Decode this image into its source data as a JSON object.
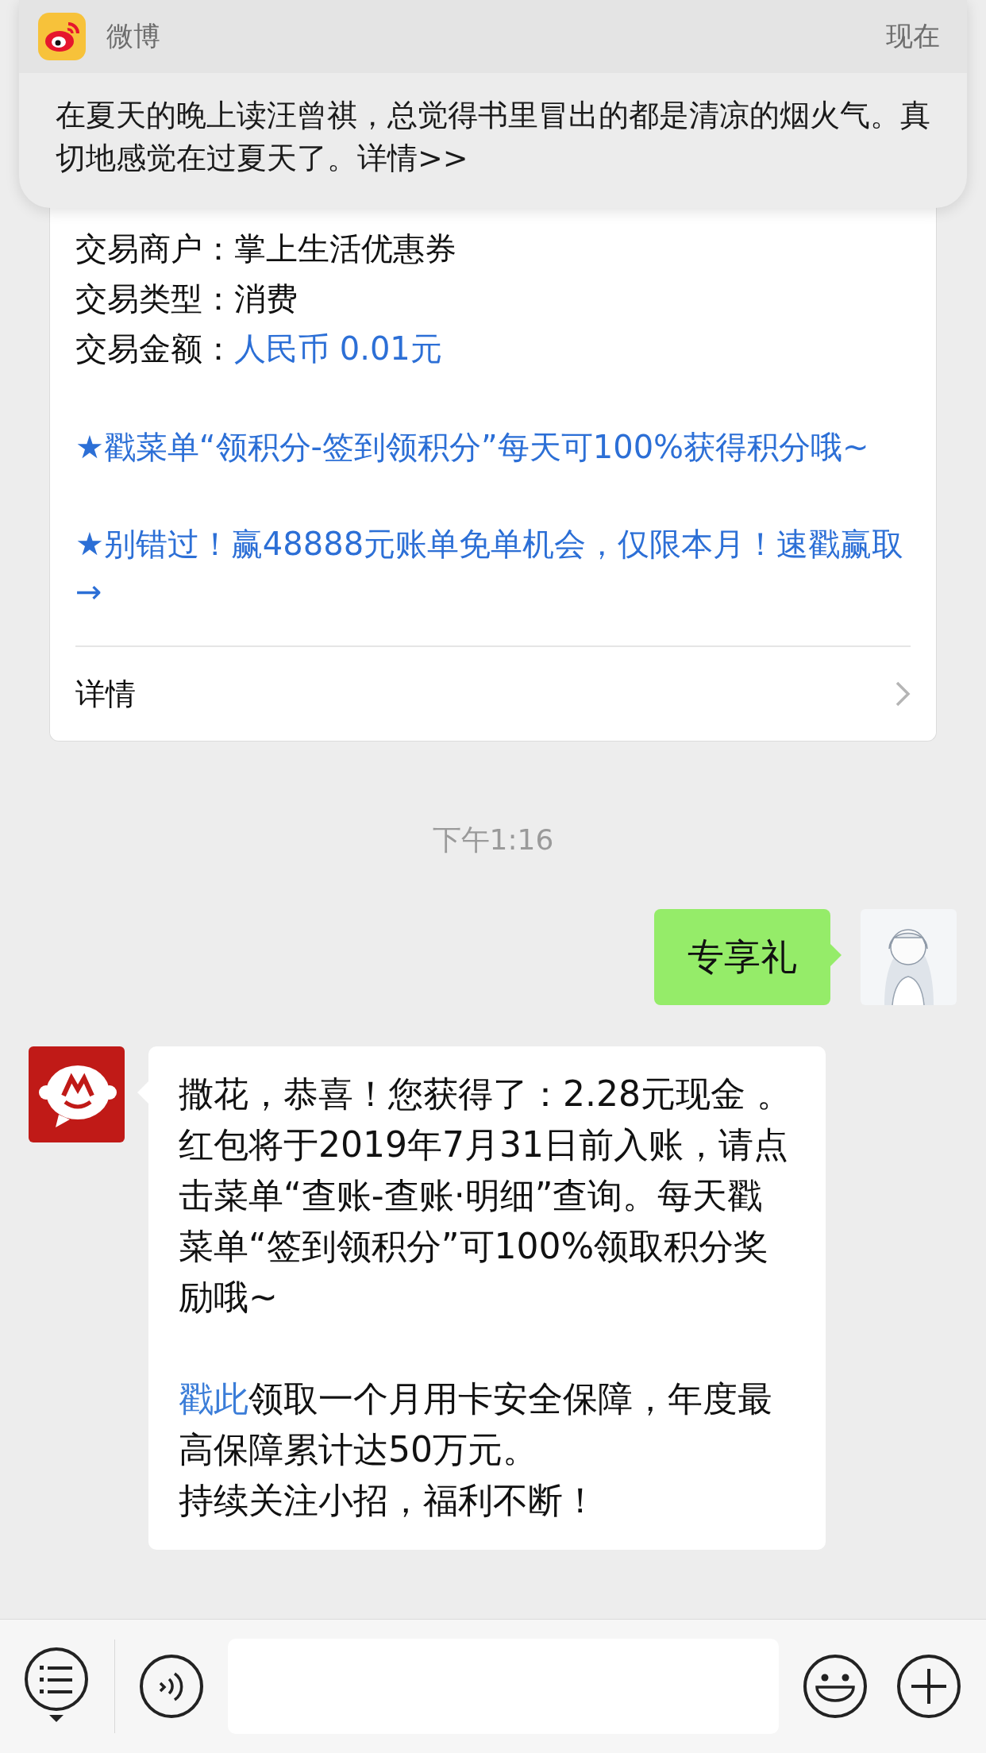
{
  "notification": {
    "app": "微博",
    "time": "现在",
    "body": "在夏天的晚上读汪曾祺，总觉得书里冒出的都是清凉的烟火气。真切地感觉在过夏天了。详情>>"
  },
  "card": {
    "rows": [
      {
        "label": "交易商户：",
        "value": "掌上生活优惠券",
        "kind": "plain"
      },
      {
        "label": "交易类型：",
        "value": "消费",
        "kind": "plain"
      },
      {
        "label": "交易金额：",
        "value": "人民币 0.01元",
        "kind": "highlight"
      }
    ],
    "promos": [
      "★戳菜单“领积分-签到领积分”每天可100%获得积分哦~",
      "★别错过！赢48888元账单免单机会，仅限本月！速戳赢取→"
    ],
    "details": "详情"
  },
  "timestamp": "下午1:16",
  "messages": [
    {
      "kind": "sent",
      "text": "专享礼"
    },
    {
      "kind": "received",
      "paragraphs": [
        {
          "text": "撒花，恭喜！您获得了：2.28元现金 。红包将于2019年7月31日前入账，请点击菜单“查账-查账·明细”查询。每天戳菜单“签到领积分”可100%领取积分奖励哦~"
        },
        {
          "link": "戳此",
          "text": "领取一个月用卡安全保障，年度最高保障累计达50万元。"
        },
        {
          "text": "持续关注小招，福利不断！"
        }
      ]
    }
  ]
}
